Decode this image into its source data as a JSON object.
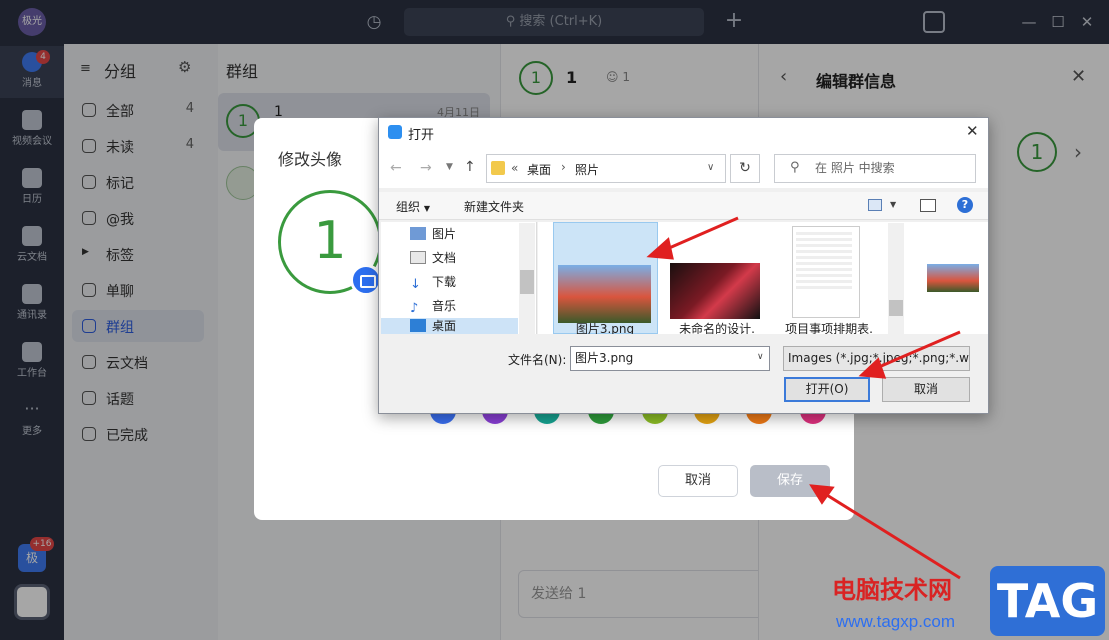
{
  "topbar": {
    "avatar_label": "极光",
    "search_placeholder": "搜索 (Ctrl+K)"
  },
  "rail": {
    "items": [
      {
        "label": "消息"
      },
      {
        "label": "视频会议"
      },
      {
        "label": "日历"
      },
      {
        "label": "云文档"
      },
      {
        "label": "通讯录"
      },
      {
        "label": "工作台"
      },
      {
        "label": "更多"
      }
    ],
    "message_badge": "4",
    "bottom_avatar": "极",
    "bottom_badge": "+16"
  },
  "groups": {
    "title": "分组",
    "items": [
      {
        "label": "全部",
        "count": "4"
      },
      {
        "label": "未读",
        "count": "4"
      },
      {
        "label": "标记"
      },
      {
        "label": "@我"
      },
      {
        "label": "标签"
      },
      {
        "label": "单聊"
      },
      {
        "label": "群组"
      },
      {
        "label": "云文档"
      },
      {
        "label": "话题"
      },
      {
        "label": "已完成"
      }
    ]
  },
  "list": {
    "title": "群组",
    "item": {
      "avatar": "1",
      "name": "1",
      "date": "4月11日"
    }
  },
  "chat": {
    "avatar": "1",
    "name": "1",
    "members": "1",
    "send_placeholder": "发送给 1"
  },
  "edit_panel": {
    "title": "编辑群信息",
    "avatar": "1"
  },
  "avatar_dialog": {
    "title": "修改头像",
    "avatar_text": "1",
    "cancel_label": "取消",
    "save_label": "保存",
    "colors": [
      "#3a6ff0",
      "#8a3fd6",
      "#17a593",
      "#2f9e3c",
      "#8dbf26",
      "#e6a513",
      "#f07a16",
      "#e0317f"
    ]
  },
  "file_dialog": {
    "title": "打开",
    "path": [
      "桌面",
      "照片"
    ],
    "path_prefix": "«",
    "search_placeholder": "在 照片 中搜索",
    "organize_label": "组织",
    "new_folder_label": "新建文件夹",
    "tree": [
      {
        "label": "图片"
      },
      {
        "label": "文档"
      },
      {
        "label": "下载"
      },
      {
        "label": "音乐"
      },
      {
        "label": "桌面"
      }
    ],
    "files": [
      {
        "label": "图片3.png",
        "selected": true
      },
      {
        "label": "未命名的设计."
      },
      {
        "label": "项目事项排期表."
      }
    ],
    "filename_label": "文件名(N):",
    "filename_value": "图片3.png",
    "filetype_value": "Images (*.jpg;*.jpeg;*.png;*.w",
    "open_label": "打开(O)",
    "cancel_label": "取消"
  },
  "watermark": {
    "site_name": "电脑技术网",
    "url": "www.tagxp.com",
    "tag": "TAG"
  }
}
